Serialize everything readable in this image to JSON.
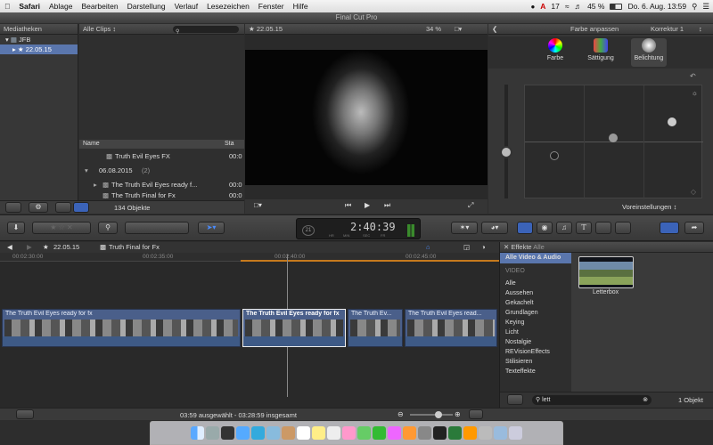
{
  "menubar": {
    "app": "Safari",
    "items": [
      "Ablage",
      "Bearbeiten",
      "Darstellung",
      "Verlauf",
      "Lesezeichen",
      "Fenster",
      "Hilfe"
    ],
    "status": {
      "badge_count": "17",
      "battery": "45 %",
      "date_time": "Do. 6. Aug.  13:59"
    }
  },
  "window_title": "Final Cut Pro",
  "library": {
    "header": "Mediatheken",
    "root": "JFB",
    "event": "22.05.15"
  },
  "browser": {
    "filter": "Alle Clips",
    "columns": {
      "name": "Name",
      "start": "Sta"
    },
    "rows": [
      {
        "name": "Truth Evil Eyes FX",
        "start": "00:0"
      },
      {
        "name": "06.08.2015",
        "count": "(2)",
        "group": true
      },
      {
        "name": "The Truth Evil Eyes ready f...",
        "start": "00:0"
      },
      {
        "name": "The Truth Final for Fx",
        "start": "00:0"
      }
    ],
    "footer": "134 Objekte"
  },
  "viewer": {
    "title": "22.05.15",
    "zoom": "34 %"
  },
  "inspector": {
    "title": "Farbe anpassen",
    "correction": "Korrektur 1",
    "tabs": [
      "Farbe",
      "Sättigung",
      "Belichtung"
    ],
    "presets": "Voreinstellungen"
  },
  "toolbar": {
    "timecode": "2:40:39",
    "frame_counter": "21",
    "tc_units": [
      "HR",
      "MIN",
      "SEC",
      "FR"
    ]
  },
  "timeline": {
    "breadcrumb_event": "22.05.15",
    "breadcrumb_project": "Truth Final for Fx",
    "ruler": [
      "00:02:30:00",
      "00:02:35:00",
      "00:02:40:00",
      "00:02:45:00"
    ],
    "clips": [
      "The Truth Evil Eyes ready for fx",
      "The Truth Evil Eyes ready for fx",
      "The Truth Ev...",
      "The Truth Evil Eyes read..."
    ],
    "status": "03:59 ausgewählt - 03:28:59 insgesamt"
  },
  "effects": {
    "header": "Effekte",
    "header_all": "Alle",
    "categories_header": "Alle Video & Audio",
    "section": "VIDEO",
    "categories": [
      "Alle",
      "Aussehen",
      "Gekachelt",
      "Grundlagen",
      "Keying",
      "Licht",
      "Nostalgie",
      "REVisionEffects",
      "Stilisieren",
      "Texteffekte"
    ],
    "thumbnail_label": "Letterbox",
    "search_value": "lett",
    "count": "1 Objekt"
  }
}
